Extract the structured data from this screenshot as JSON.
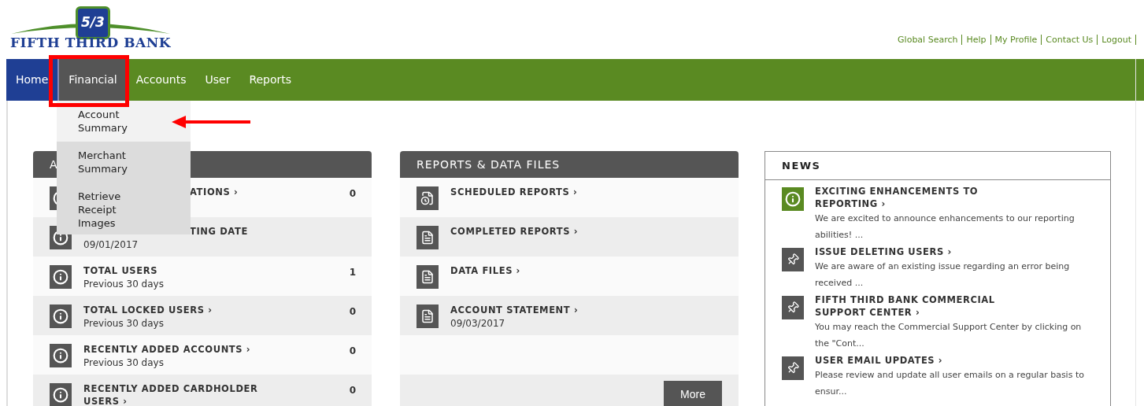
{
  "logo": {
    "mark": "5/3",
    "name": "FIFTH THIRD BANK"
  },
  "top_links": [
    "Global Search",
    "Help",
    "My Profile",
    "Contact Us",
    "Logout"
  ],
  "nav": [
    {
      "label": "Home",
      "kind": "home",
      "selected": false
    },
    {
      "label": "Financial",
      "kind": "menu",
      "selected": true
    },
    {
      "label": "Accounts",
      "kind": "menu",
      "selected": false
    },
    {
      "label": "User",
      "kind": "menu",
      "selected": false
    },
    {
      "label": "Reports",
      "kind": "menu",
      "selected": false
    }
  ],
  "dropdown": [
    {
      "label": "Account Summary",
      "selected": true
    },
    {
      "label": "Merchant Summary",
      "selected": false
    },
    {
      "label": "Retrieve Receipt Images",
      "selected": false
    }
  ],
  "left_panel": {
    "title": "A",
    "rows": [
      {
        "title": "ATIONS ›",
        "count": "0",
        "covered": true
      },
      {
        "title": "TING DATE",
        "subtitle": "09/01/2017",
        "covered": true
      },
      {
        "title": "TOTAL USERS",
        "subtitle": "Previous 30 days",
        "count": "1",
        "covered": false
      },
      {
        "title": "TOTAL LOCKED USERS ›",
        "subtitle": "Previous 30 days",
        "count": "0",
        "covered": false
      },
      {
        "title": "RECENTLY ADDED ACCOUNTS ›",
        "subtitle": "Previous 30 days",
        "count": "0",
        "covered": false
      },
      {
        "title": "RECENTLY ADDED CARDHOLDER USERS ›",
        "count": "0",
        "covered": false
      }
    ]
  },
  "reports_panel": {
    "title": "REPORTS & DATA FILES",
    "rows": [
      {
        "title": "SCHEDULED REPORTS ›",
        "kind": "scheduled"
      },
      {
        "title": "COMPLETED REPORTS ›",
        "kind": "document"
      },
      {
        "title": "DATA FILES ›",
        "kind": "document"
      },
      {
        "title": "ACCOUNT STATEMENT ›",
        "subtitle": "09/03/2017",
        "kind": "pdf"
      }
    ],
    "button": "More"
  },
  "news": {
    "title": "NEWS",
    "items": [
      {
        "title": "EXCITING ENHANCEMENTS TO REPORTING ›",
        "body": "We are excited to announce enhancements to our reporting abilities! ...",
        "kind": "info"
      },
      {
        "title": "ISSUE DELETING USERS ›",
        "body": "We are aware of an existing issue regarding an error being received ...",
        "kind": "pin"
      },
      {
        "title": "FIFTH THIRD BANK COMMERCIAL SUPPORT CENTER ›",
        "body": "You may reach the Commercial Support Center by clicking on the \"Cont...",
        "kind": "pin"
      },
      {
        "title": "USER EMAIL UPDATES ›",
        "body": "Please review and update all user emails on a regular basis to ensur...",
        "kind": "pin"
      }
    ]
  }
}
